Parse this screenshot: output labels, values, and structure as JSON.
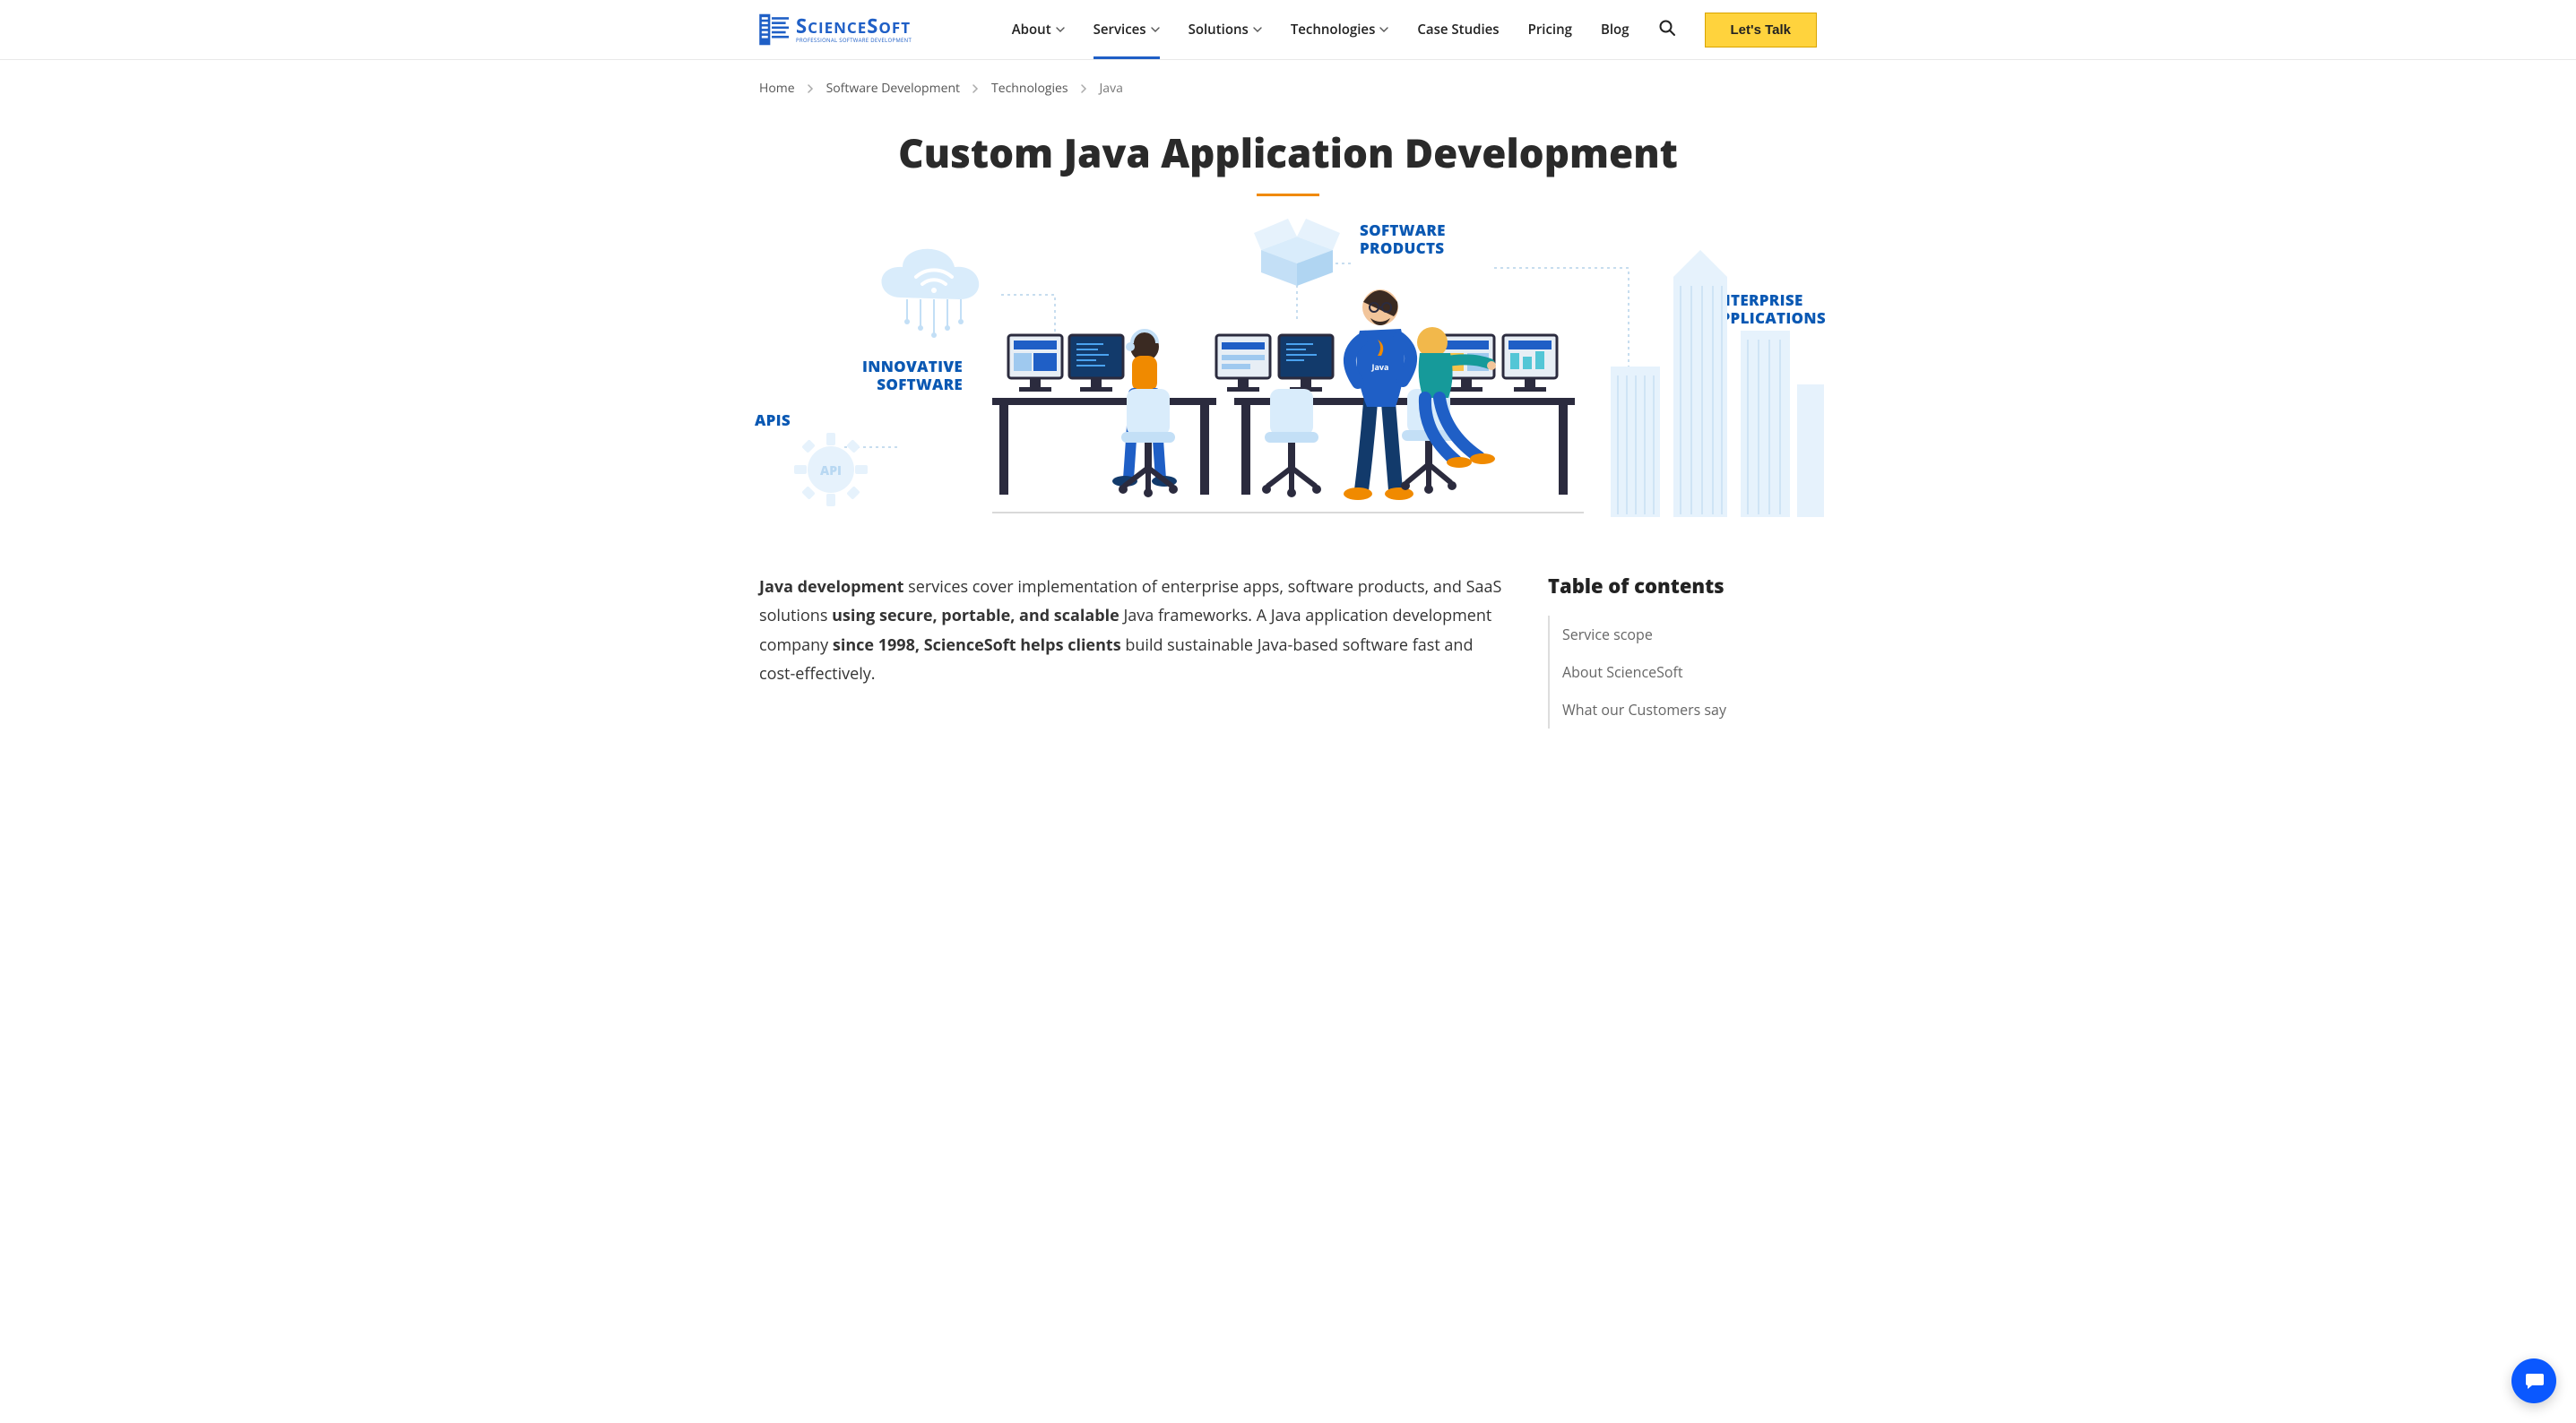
{
  "logo": {
    "brand_prefix": "S",
    "brand_mid": "CIENCE",
    "brand_suffix": "S",
    "brand_end": "OFT",
    "tagline": "Professional Software Development"
  },
  "nav": {
    "items": [
      {
        "label": "About",
        "has_menu": true,
        "active": false
      },
      {
        "label": "Services",
        "has_menu": true,
        "active": true
      },
      {
        "label": "Solutions",
        "has_menu": true,
        "active": false
      },
      {
        "label": "Technologies",
        "has_menu": true,
        "active": false
      },
      {
        "label": "Case Studies",
        "has_menu": false,
        "active": false
      },
      {
        "label": "Pricing",
        "has_menu": false,
        "active": false
      },
      {
        "label": "Blog",
        "has_menu": false,
        "active": false
      }
    ],
    "cta": "Let's Talk"
  },
  "breadcrumb": [
    {
      "label": "Home",
      "link": true
    },
    {
      "label": "Software Development",
      "link": true
    },
    {
      "label": "Technologies",
      "link": true
    },
    {
      "label": "Java",
      "link": false
    }
  ],
  "title": "Custom Java Application Development",
  "hero_labels": {
    "apis": "APIS",
    "api_gear": "API",
    "innovative": "INNOVATIVE\nSOFTWARE",
    "products": "SOFTWARE\nPRODUCTS",
    "enterprise": "ENTERPRISE\nAPPLICATIONS"
  },
  "lead": {
    "p1_b1": "Java development",
    "p1_t1": " services cover implementation of enterprise apps, software products, and SaaS solutions ",
    "p1_b2": "using secure, portable, and scalable",
    "p1_t2": " Java frameworks. A Java application development company ",
    "p1_b3": "since 1998, ScienceSoft helps clients",
    "p1_t3": " build sustainable Java-based software fast and cost-effectively."
  },
  "toc": {
    "title": "Table of contents",
    "items": [
      "Service scope",
      "About ScienceSoft",
      "What our Customers say"
    ]
  },
  "colors": {
    "brand_blue": "#1f5fc6",
    "accent_orange": "#f08a00",
    "cta_yellow": "#ffd33d",
    "label_blue": "#0a58b3",
    "pale_blue": "#d9ecfb",
    "mid_blue": "#5aa7e6"
  }
}
